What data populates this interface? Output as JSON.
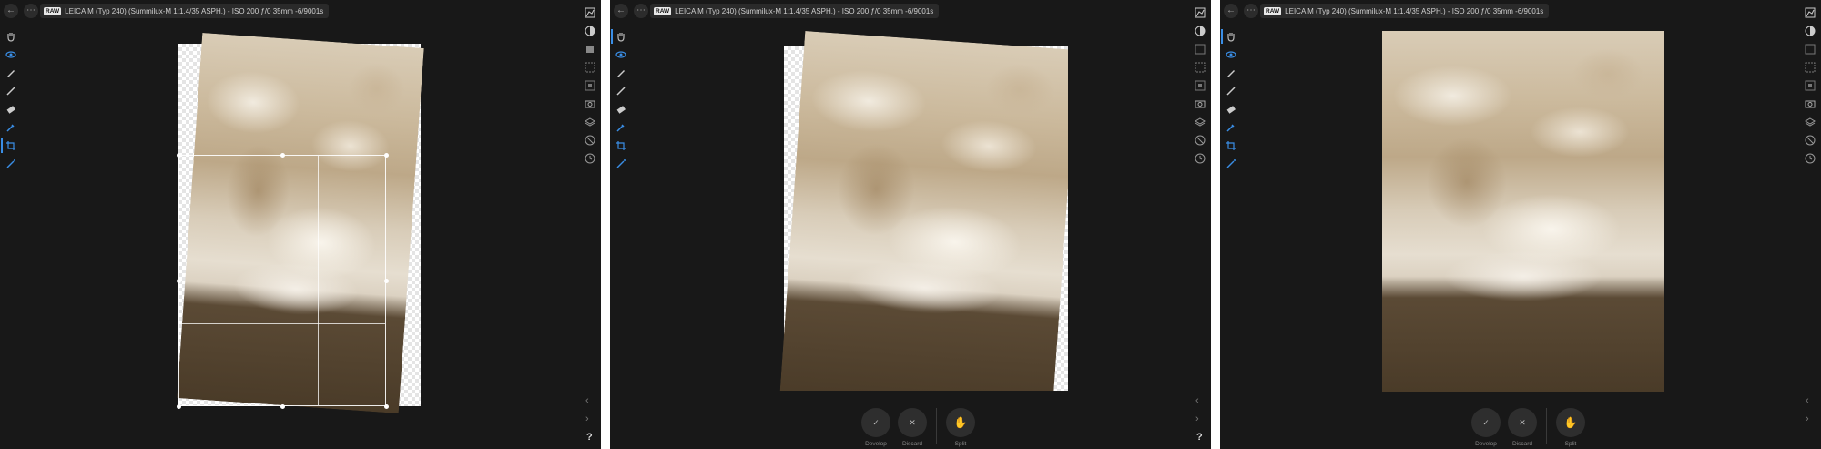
{
  "panels": [
    {
      "id": "panel-1",
      "back_icon": "back-arrow-icon",
      "more_icon": "more-dots-icon",
      "raw_badge": "RAW",
      "camera_info": "LEICA M (Typ 240) (Summilux-M 1:1.4/35 ASPH.) - ISO 200 ƒ/0 35mm -6/9001s",
      "mode": "crop-editing",
      "help_label": "?"
    },
    {
      "id": "panel-2",
      "back_icon": "back-arrow-icon",
      "more_icon": "more-dots-icon",
      "raw_badge": "RAW",
      "camera_info": "LEICA M (Typ 240) (Summilux-M 1:1.4/35 ASPH.) - ISO 200 ƒ/0 35mm -6/9001s",
      "mode": "rotated-preview",
      "help_label": "?",
      "bottom_buttons": [
        {
          "label": "Develop",
          "icon": "check-icon",
          "glyph": "✓"
        },
        {
          "label": "Discard",
          "icon": "close-icon",
          "glyph": "✕"
        },
        {
          "label": "Split",
          "icon": "split-hand-icon",
          "glyph": "✋"
        }
      ]
    },
    {
      "id": "panel-3",
      "back_icon": "back-arrow-icon",
      "more_icon": "more-dots-icon",
      "raw_badge": "RAW",
      "camera_info": "LEICA M (Typ 240) (Summilux-M 1:1.4/35 ASPH.) - ISO 200 ƒ/0 35mm -6/9001s",
      "mode": "final-preview",
      "help_label": "?",
      "bottom_buttons": [
        {
          "label": "Develop",
          "icon": "check-icon",
          "glyph": "✓"
        },
        {
          "label": "Discard",
          "icon": "close-icon",
          "glyph": "✕"
        },
        {
          "label": "Split",
          "icon": "split-hand-icon",
          "glyph": "✋"
        }
      ]
    }
  ],
  "left_tools": [
    "hand-tool-icon",
    "eye-tool-icon",
    "brush-tool-icon",
    "paintbrush-tool-icon",
    "eraser-tool-icon",
    "eyedropper-tool-icon",
    "crop-tool-icon",
    "wand-tool-icon"
  ],
  "right_tools": [
    "histogram-icon",
    "tone-icon",
    "crop-panel-icon",
    "selection-icon",
    "overlay-icon",
    "camera-icon",
    "layers-icon",
    "lens-icon",
    "history-icon"
  ],
  "colors": {
    "panel_bg": "#181818",
    "accent": "#3a8ee6",
    "separator": "#ffffff"
  }
}
